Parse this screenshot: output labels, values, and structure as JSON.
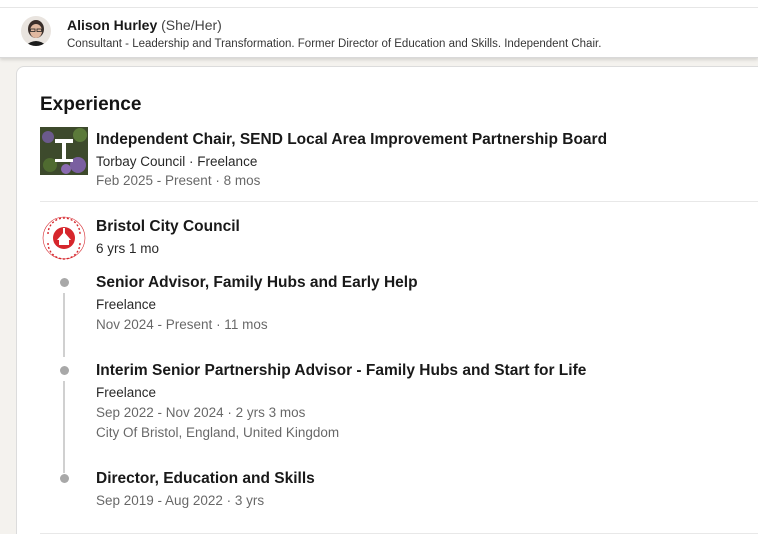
{
  "profile": {
    "name": "Alison Hurley",
    "pronouns": "(She/Her)",
    "headline": "Consultant - Leadership and Transformation. Former Director of Education and Skills. Independent Chair."
  },
  "experience": {
    "heading": "Experience",
    "entries": [
      {
        "title": "Independent Chair, SEND Local Area Improvement Partnership Board",
        "company_line": "Torbay Council · Freelance",
        "dates": "Feb 2025 - Present · 8 mos"
      }
    ],
    "group": {
      "company": "Bristol City Council",
      "duration": "6 yrs 1 mo",
      "logo_text": "BRISTOL CITY COUNCIL",
      "roles": [
        {
          "title": "Senior Advisor, Family Hubs and Early Help",
          "type": "Freelance",
          "dates": "Nov 2024 - Present · 11 mos"
        },
        {
          "title": "Interim Senior Partnership Advisor - Family Hubs and Start for Life",
          "type": "Freelance",
          "dates": "Sep 2022 - Nov 2024 · 2 yrs 3 mos",
          "location": "City Of Bristol, England, United Kingdom"
        },
        {
          "title": "Director, Education and Skills",
          "dates": "Sep 2019 - Aug 2022 · 3 yrs"
        }
      ]
    }
  },
  "colors": {
    "accent_red": "#d6262c",
    "page_bg": "#f4f2ee"
  }
}
